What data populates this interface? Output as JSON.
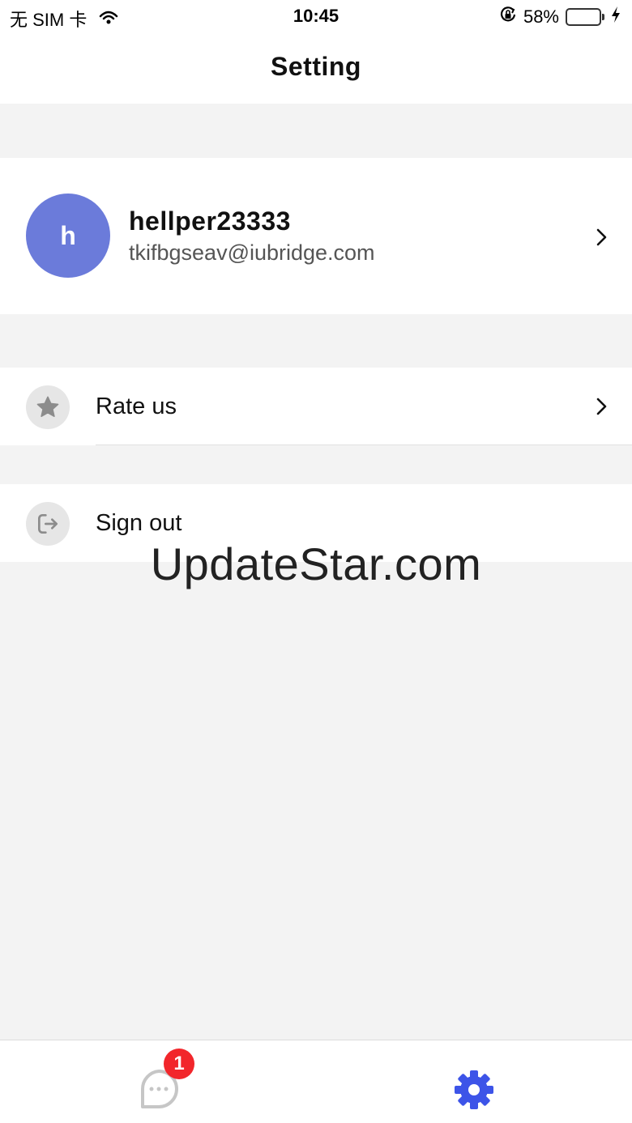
{
  "status_bar": {
    "carrier": "无 SIM 卡",
    "time": "10:45",
    "battery_percent": "58%",
    "battery_level": 0.58,
    "icons": [
      "wifi-icon",
      "rotation-lock-icon",
      "battery-icon",
      "charging-icon"
    ]
  },
  "nav": {
    "title": "Setting"
  },
  "profile": {
    "avatar_letter": "h",
    "avatar_color": "#6b7bda",
    "username": "hellper23333",
    "email": "tkifbgseav@iubridge.com"
  },
  "menu": {
    "rate_label": "Rate us",
    "signout_label": "Sign out"
  },
  "watermark": "UpdateStar.com",
  "tab_bar": {
    "tabs": [
      {
        "name": "messages",
        "icon": "chat-bubble-icon",
        "badge": "1"
      },
      {
        "name": "settings",
        "icon": "gear-icon",
        "active": true
      }
    ],
    "accent_color": "#3d54e8"
  }
}
